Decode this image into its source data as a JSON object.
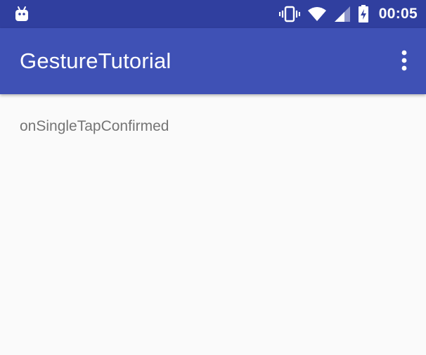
{
  "status_bar": {
    "time": "00:05",
    "icons": [
      "android-icon",
      "vibrate-icon",
      "wifi-icon",
      "signal-icon",
      "battery-charging-icon"
    ],
    "color": "#303f9f"
  },
  "app_bar": {
    "title": "GestureTutorial",
    "color": "#3f51b5",
    "overflow_icon": "more-vert-icon"
  },
  "content": {
    "gesture_text": "onSingleTapConfirmed",
    "text_color": "#757575",
    "background": "#fafafa"
  }
}
